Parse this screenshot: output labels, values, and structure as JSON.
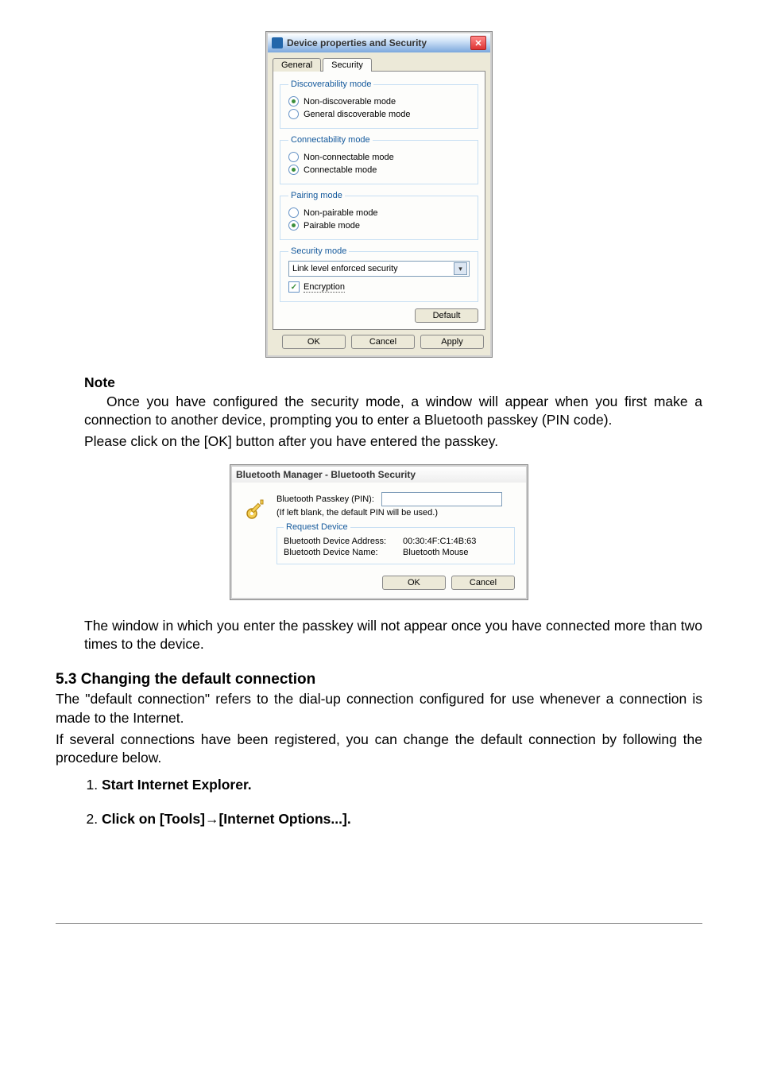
{
  "dialog1": {
    "title": "Device properties and Security",
    "tabs": {
      "general": "General",
      "security": "Security"
    },
    "fieldsets": {
      "discover": {
        "legend": "Discoverability mode",
        "opt_nondisc": "Non-discoverable mode",
        "opt_general": "General discoverable mode"
      },
      "connect": {
        "legend": "Connectability mode",
        "opt_nonconn": "Non-connectable mode",
        "opt_conn": "Connectable mode"
      },
      "pairing": {
        "legend": "Pairing mode",
        "opt_nonpair": "Non-pairable mode",
        "opt_pair": "Pairable mode"
      },
      "security": {
        "legend": "Security mode",
        "dropdown_value": "Link level enforced security",
        "encryption_label": "Encryption"
      }
    },
    "buttons": {
      "default": "Default",
      "ok": "OK",
      "cancel": "Cancel",
      "apply": "Apply"
    }
  },
  "note": {
    "heading": "Note",
    "p1": "Once you have configured the security mode, a window will appear when you first make a connection to another device, prompting you to enter a Bluetooth passkey (PIN code).",
    "p2": "Please click on the [OK] button after you have entered the passkey."
  },
  "dialog2": {
    "title": "Bluetooth Manager - Bluetooth Security",
    "passkey_label": "Bluetooth Passkey (PIN):",
    "hint": "(If left blank, the default PIN will be used.)",
    "request_legend": "Request Device",
    "addr_label": "Bluetooth Device Address:",
    "addr_value": "00:30:4F:C1:4B:63",
    "name_label": "Bluetooth Device Name:",
    "name_value": "Bluetooth Mouse",
    "ok": "OK",
    "cancel": "Cancel"
  },
  "after_dialog2": "The window in which you enter the passkey will not appear once you have connected more than two times to the device.",
  "section53": {
    "heading": "5.3  Changing the default connection",
    "p1": "The \"default connection\" refers to the dial-up connection configured for use whenever a connection is made to the Internet.",
    "p2": "If several connections have been registered, you can change the default connection by following the procedure below.",
    "step1": "Start Internet Explorer.",
    "step2": "Click on [Tools]→[Internet Options...]."
  }
}
